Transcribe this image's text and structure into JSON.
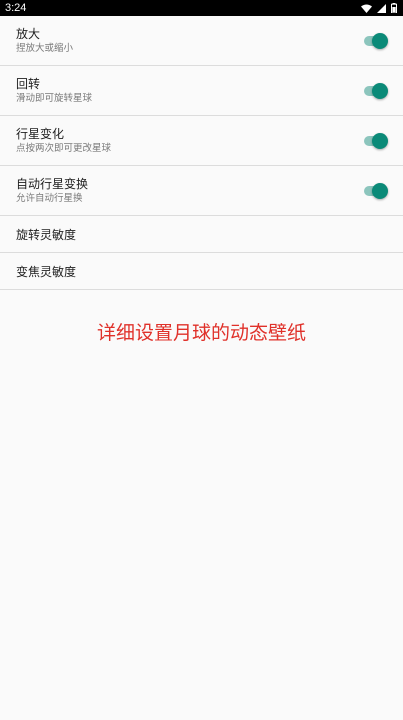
{
  "status_bar": {
    "time": "3:24",
    "icons": [
      "wifi-icon",
      "signal-icon",
      "battery-icon"
    ]
  },
  "settings": {
    "items": [
      {
        "title": "放大",
        "subtitle": "捏放大或缩小",
        "switch_on": true
      },
      {
        "title": "回转",
        "subtitle": "滑动即可旋转星球",
        "switch_on": true
      },
      {
        "title": "行星变化",
        "subtitle": "点按两次即可更改星球",
        "switch_on": true
      },
      {
        "title": "自动行星变换",
        "subtitle": "允许自动行星换",
        "switch_on": true
      },
      {
        "title": "旋转灵敏度"
      },
      {
        "title": "变焦灵敏度"
      }
    ]
  },
  "caption": "详细设置月球的动态壁纸",
  "colors": {
    "accent": "#0b8a78",
    "track": "#8cc5bd",
    "caption": "#e0312a",
    "background": "#fafafa",
    "divider": "#dcdcdc"
  }
}
